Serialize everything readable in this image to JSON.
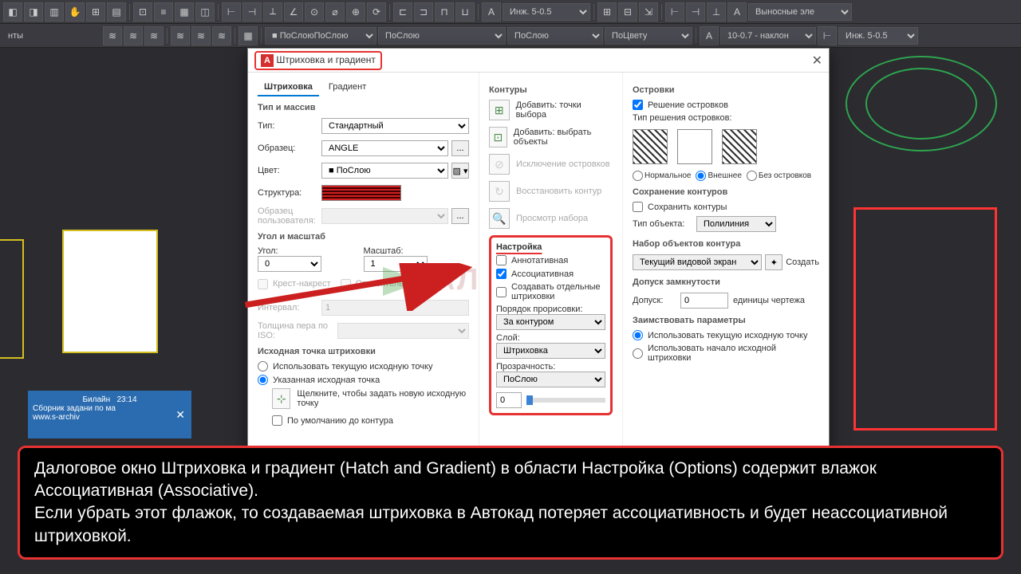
{
  "toolbar1": {
    "style_label": "Инж. 5-0.5",
    "dim_label": "Выносные эле"
  },
  "toolbar2": {
    "tab_label": "нты",
    "layer": "ПоСлою",
    "ltype": "ПоСлою",
    "lweight": "ПоСлою",
    "color": "ПоЦвету",
    "tstyle": "10-0.7 - наклон",
    "dstyle": "Инж. 5-0.5"
  },
  "phone": {
    "carrier": "Билайн",
    "time": "23:14",
    "title": "Сборник задани по ма",
    "url": "www.s-archiv"
  },
  "dialog": {
    "title": "Штриховка и градиент",
    "tabs": {
      "hatch": "Штриховка",
      "gradient": "Градиент"
    },
    "type_group": "Тип и массив",
    "type_label": "Тип:",
    "type_value": "Стандартный",
    "pattern_label": "Образец:",
    "pattern_value": "ANGLE",
    "color_label": "Цвет:",
    "color_value": "ПоСлою",
    "struct_label": "Структура:",
    "user_label": "Образец пользователя:",
    "angle_group": "Угол и масштаб",
    "angle_label": "Угол:",
    "angle_value": "0",
    "scale_label": "Масштаб:",
    "scale_value": "1",
    "crosshatch": "Крест-накрест",
    "relative": "Относительно листа",
    "interval_label": "Интервал:",
    "interval_value": "1",
    "iso_label": "Толщина пера по ISO:",
    "origin_group": "Исходная точка штриховки",
    "origin_current": "Использовать текущую исходную точку",
    "origin_specified": "Указанная исходная точка",
    "origin_pick": "Щелкните, чтобы задать новую исходную точку",
    "origin_default": "По умолчанию до контура",
    "boundaries": "Контуры",
    "add_points": "Добавить: точки выбора",
    "add_objects": "Добавить: выбрать объекты",
    "remove_bound": "Исключение островков",
    "recreate": "Восстановить контур",
    "view_sel": "Просмотр набора",
    "options": "Настройка",
    "annotative": "Аннотативная",
    "associative": "Ассоциативная",
    "separate": "Создавать отдельные штриховки",
    "draw_order_label": "Порядок прорисовки:",
    "draw_order": "За контуром",
    "layer_label": "Слой:",
    "layer": "Штриховка",
    "transp_label": "Прозрачность:",
    "transp": "ПоСлою",
    "transp_num": "0",
    "islands": "Островки",
    "island_detect": "Решение островков",
    "island_type": "Тип решения островков:",
    "island_normal": "Нормальное",
    "island_outer": "Внешнее",
    "island_ignore": "Без островков",
    "retain_group": "Сохранение контуров",
    "retain": "Сохранить контуры",
    "objtype_label": "Тип объекта:",
    "objtype": "Полилиния",
    "bset_group": "Набор объектов контура",
    "bset": "Текущий видовой экран",
    "bset_new": "Создать",
    "gap_group": "Допуск замкнутости",
    "gap_label": "Допуск:",
    "gap_value": "0",
    "gap_units": "единицы чертежа",
    "inherit_group": "Заимствовать параметры",
    "inherit_current": "Использовать текущую исходную точку",
    "inherit_source": "Использовать начало исходной штриховки"
  },
  "caption": {
    "line1": "Далоговое окно Штриховка и градиент (Hatch and Gradient) в области Настройка (Options) содержит влажок Ассоциативная (Associative).",
    "line2": "Если убрать этот флажок, то создаваемая штриховка в Автокад потеряет ассоциативность и будет неассоциативной штриховкой."
  }
}
